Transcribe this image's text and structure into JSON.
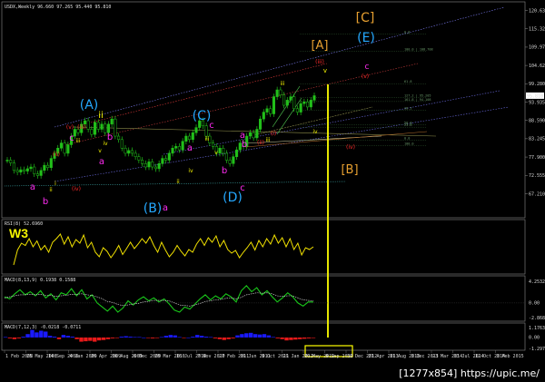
{
  "chart_title": "USDX,Weekly 96.660 97.265 95.440 95.810",
  "watermark": "[1277x854] https://upic.me/",
  "colors": {
    "background": "#000000",
    "frame": "#8a8a8a",
    "bull_candle": "#22c01a",
    "bear_candle": "#22c01a",
    "rsi_line": "#f0e000",
    "macd_line": "#19c81a",
    "macd_signal": "#e4e4e4",
    "hist_pos": "#1a1aff",
    "hist_neg": "#e81a1a",
    "vertical_marker": "#ffff00",
    "wave_magenta": "#ff2bf1",
    "wave_cyan": "#25a8ff",
    "wave_red": "#ff2a2a",
    "wave_yellow": "#f5f500",
    "wave_orange": "#e8a030"
  },
  "chart_data": [
    {
      "type": "line",
      "name": "main",
      "ylim": [
        62.3,
        121.6
      ],
      "price_ticks": [
        "120.635",
        "115.325",
        "109.970",
        "104.625",
        "99.280",
        "93.935",
        "88.590",
        "83.245",
        "77.900",
        "72.555",
        "67.210"
      ],
      "current_price": "95.810",
      "candle_closes": [
        77.0,
        76.2,
        74.0,
        73.5,
        74.2,
        73.8,
        74.5,
        75.0,
        73.0,
        72.5,
        74.0,
        75.5,
        74.8,
        77.5,
        79.0,
        80.5,
        82.0,
        79.0,
        81.5,
        84.0,
        86.0,
        85.0,
        87.5,
        88.5,
        86.0,
        84.5,
        88.0,
        86.0,
        87.5,
        85.0,
        87.5,
        89.0,
        84.0,
        83.0,
        80.5,
        79.0,
        79.8,
        79.0,
        78.0,
        77.0,
        76.0,
        75.0,
        76.5,
        75.0,
        74.5,
        76.0,
        77.5,
        77.0,
        79.0,
        80.5,
        81.0,
        80.0,
        82.5,
        84.0,
        83.0,
        85.0,
        86.5,
        88.5,
        87.0,
        84.0,
        82.0,
        81.0,
        79.0,
        80.5,
        79.0,
        77.0,
        76.0,
        78.0,
        80.0,
        82.0,
        81.0,
        84.0,
        85.0,
        83.5,
        86.0,
        89.0,
        91.0,
        92.0,
        90.5,
        95.5,
        97.5,
        96.0,
        93.0,
        94.5,
        95.5,
        92.0,
        91.0,
        93.5,
        94.0,
        92.5,
        94.5,
        95.8
      ],
      "fib_levels": [
        {
          "label": "0.0",
          "price": 113.8
        },
        {
          "label": "100.0 | 108.708",
          "price": 108.7
        },
        {
          "label": "61.8",
          "price": 99.3
        },
        {
          "label": "127.2 | 95.205",
          "price": 95.2
        },
        {
          "label": "161.8 | 94.108",
          "price": 94.1
        },
        {
          "label": "38.2",
          "price": 91.6
        },
        {
          "label": "50.0",
          "price": 87.3
        },
        {
          "label": "23.6",
          "price": 86.6
        },
        {
          "label": "0.0",
          "price": 82.8
        },
        {
          "label": "100.0",
          "price": 81.2
        }
      ],
      "wave_labels": [
        {
          "text": "[C]",
          "color_key": "wave_orange"
        },
        {
          "text": "[A]",
          "color_key": "wave_orange"
        },
        {
          "text": "[B]",
          "color_key": "wave_orange"
        },
        {
          "text": "(E)",
          "color_key": "wave_cyan"
        },
        {
          "text": "(A)",
          "color_key": "wave_cyan"
        },
        {
          "text": "(C)",
          "color_key": "wave_cyan"
        },
        {
          "text": "(B)",
          "color_key": "wave_cyan"
        },
        {
          "text": "(D)",
          "color_key": "wave_cyan"
        },
        {
          "text": "c",
          "color_key": "wave_magenta"
        },
        {
          "text": "(v)",
          "color_key": "wave_red"
        },
        {
          "text": "(iii)",
          "color_key": "wave_red"
        },
        {
          "text": "v",
          "color_key": "wave_yellow"
        },
        {
          "text": "iii",
          "color_key": "wave_yellow"
        },
        {
          "text": "iv",
          "color_key": "wave_yellow"
        },
        {
          "text": "(iv)",
          "color_key": "wave_red"
        },
        {
          "text": "(iii)",
          "color_key": "wave_red"
        },
        {
          "text": "(v)",
          "color_key": "wave_red"
        },
        {
          "text": "c",
          "color_key": "wave_magenta"
        },
        {
          "text": "b",
          "color_key": "wave_magenta"
        },
        {
          "text": "a",
          "color_key": "wave_magenta"
        },
        {
          "text": "(ii)",
          "color_key": "wave_red"
        },
        {
          "text": "(iv)",
          "color_key": "wave_red"
        },
        {
          "text": "a",
          "color_key": "wave_magenta"
        },
        {
          "text": "b",
          "color_key": "wave_magenta"
        },
        {
          "text": "c",
          "color_key": "wave_magenta"
        },
        {
          "text": "a",
          "color_key": "wave_magenta"
        },
        {
          "text": "b",
          "color_key": "wave_magenta"
        },
        {
          "text": "a",
          "color_key": "wave_magenta"
        },
        {
          "text": "c",
          "color_key": "wave_magenta"
        },
        {
          "text": "a",
          "color_key": "wave_magenta"
        },
        {
          "text": "iii",
          "color_key": "wave_yellow"
        },
        {
          "text": "v",
          "color_key": "wave_yellow"
        },
        {
          "text": "iv",
          "color_key": "wave_yellow"
        },
        {
          "text": "ii",
          "color_key": "wave_yellow"
        },
        {
          "text": "iii",
          "color_key": "wave_yellow"
        },
        {
          "text": "i",
          "color_key": "wave_yellow"
        },
        {
          "text": "ii",
          "color_key": "wave_yellow"
        },
        {
          "text": "(i)",
          "color_key": "wave_red"
        },
        {
          "text": "(ii)",
          "color_key": "wave_red"
        },
        {
          "text": "iii",
          "color_key": "wave_yellow"
        },
        {
          "text": "v",
          "color_key": "wave_yellow"
        },
        {
          "text": "b",
          "color_key": "wave_magenta"
        },
        {
          "text": "ii",
          "color_key": "wave_yellow"
        },
        {
          "text": "iv",
          "color_key": "wave_yellow"
        }
      ]
    },
    {
      "type": "line",
      "name": "rsi",
      "title": "RSI(8) 52.6960",
      "label": "W3",
      "values": [
        12,
        45,
        60,
        55,
        70,
        52,
        65,
        45,
        55,
        40,
        62,
        70,
        80,
        58,
        74,
        52,
        68,
        60,
        78,
        50,
        62,
        40,
        30,
        50,
        42,
        28,
        40,
        55,
        35,
        48,
        62,
        48,
        58,
        70,
        60,
        74,
        55,
        40,
        62,
        45,
        30,
        40,
        55,
        42,
        32,
        46,
        40,
        58,
        70,
        55,
        72,
        62,
        76,
        52,
        66,
        46,
        38,
        44,
        28,
        40,
        50,
        62,
        45,
        66,
        52,
        70,
        58,
        78,
        60,
        72,
        52,
        70,
        46,
        60,
        34,
        50,
        46,
        52
      ]
    },
    {
      "type": "line",
      "name": "macd",
      "title": "MACD(8,13,9) 0.1938 0.1588",
      "ticks": [
        "4.2532",
        "0.00",
        "-2.8689"
      ],
      "macd": [
        1.2,
        0.8,
        1.8,
        2.6,
        1.6,
        2.2,
        1.4,
        2.4,
        1.0,
        1.8,
        0.6,
        2.0,
        1.6,
        2.8,
        1.4,
        2.6,
        0.8,
        1.6,
        0.0,
        -0.8,
        -1.6,
        -0.6,
        -1.8,
        -1.0,
        0.4,
        -0.4,
        0.6,
        1.2,
        0.4,
        1.0,
        0.2,
        0.8,
        -0.2,
        -1.4,
        -1.8,
        -0.8,
        -1.2,
        -0.2,
        0.8,
        1.6,
        0.6,
        1.4,
        0.8,
        1.8,
        1.2,
        0.2,
        2.4,
        3.4,
        2.2,
        3.0,
        1.6,
        2.4,
        1.2,
        0.2,
        1.0,
        2.0,
        1.2,
        0.0,
        -0.6,
        0.2,
        0.2
      ],
      "signal": [
        1.0,
        1.2,
        1.4,
        1.6,
        1.6,
        1.7,
        1.6,
        1.7,
        1.5,
        1.5,
        1.3,
        1.4,
        1.5,
        1.7,
        1.7,
        1.8,
        1.6,
        1.5,
        1.2,
        0.8,
        0.3,
        0.1,
        -0.3,
        -0.5,
        -0.4,
        -0.2,
        -0.1,
        0.2,
        0.3,
        0.5,
        0.5,
        0.5,
        0.4,
        0.0,
        -0.4,
        -0.5,
        -0.6,
        -0.4,
        -0.1,
        0.3,
        0.4,
        0.6,
        0.7,
        0.9,
        1.0,
        0.8,
        1.1,
        1.6,
        1.8,
        2.0,
        1.9,
        2.0,
        1.8,
        1.4,
        1.3,
        1.4,
        1.4,
        1.0,
        0.6,
        0.5,
        0.4
      ]
    },
    {
      "type": "bar",
      "name": "macd_hist",
      "title": "MACD(7,12,3) -0.0218 -0.0711",
      "ticks": [
        "1.1763",
        "0.00",
        "-1.2977"
      ],
      "values": [
        0.05,
        -0.1,
        -0.2,
        -0.1,
        0.1,
        0.4,
        0.9,
        0.6,
        0.8,
        0.7,
        0.2,
        0.1,
        -0.2,
        0.3,
        0.2,
        0.1,
        -0.2,
        -0.5,
        -0.45,
        -0.4,
        -0.5,
        -0.35,
        -0.3,
        -0.2,
        -0.1,
        -0.05,
        0.1,
        0.15,
        0.1,
        0.05,
        0.05,
        0.0,
        -0.05,
        -0.1,
        -0.05,
        0.05,
        0.2,
        0.3,
        0.25,
        0.05,
        -0.05,
        0.0,
        0.1,
        0.3,
        0.2,
        0.1,
        0.05,
        -0.1,
        -0.2,
        -0.3,
        -0.2,
        -0.1,
        0.25,
        0.4,
        0.5,
        0.55,
        0.4,
        0.35,
        0.4,
        0.25,
        0.05,
        -0.1,
        -0.2,
        -0.35,
        -0.3,
        -0.25,
        -0.2,
        -0.15,
        -0.1,
        -0.05
      ]
    }
  ],
  "date_labels": [
    "1 Feb 2008",
    "25 May 2008",
    "14 Sep 2008",
    "4 Jan 2009",
    "26 Apr 2009",
    "16 Aug 2009",
    "6 Dec 2009",
    "28 Mar 2010",
    "18 Jul 2010",
    "7 Nov 2010",
    "27 Feb 2011",
    "19 Jun 2011",
    "9 Oct 2011",
    "29 Jan 2012",
    "20 May 2012",
    "9 Sep 2012",
    "30 Dec 2012",
    "21 Apr 2013",
    "11 Aug 2013",
    "1 Dec 2013",
    "23 Mar 2014",
    "13 Jul 2014",
    "12 Oct 2014",
    "1 Feb 2015",
    "24 May 2015"
  ]
}
